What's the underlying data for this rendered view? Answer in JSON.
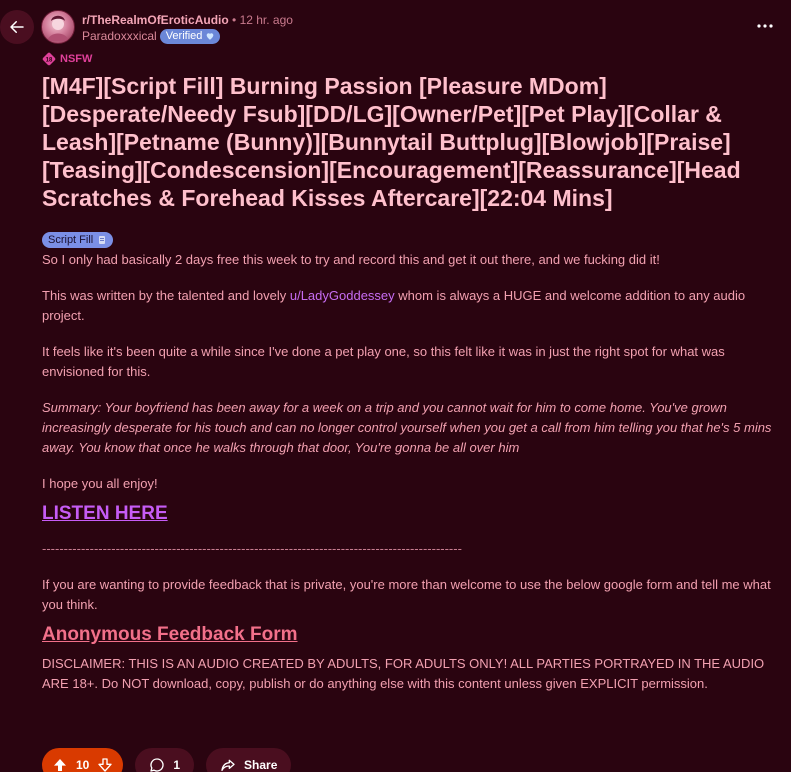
{
  "header": {
    "subreddit": "r/TheRealmOfEroticAudio",
    "separator": "•",
    "time_ago": "12 hr. ago",
    "username": "Paradoxxxical",
    "verified_label": "Verified"
  },
  "nsfw_label": "NSFW",
  "post": {
    "title": "[M4F][Script Fill] Burning Passion [Pleasure MDom][Desperate/Needy Fsub][DD/LG][Owner/Pet][Pet Play][Collar & Leash][Petname (Bunny)][Bunnytail Buttplug][Blowjob][Praise][Teasing][Condescension][Encouragement][Reassurance][Head Scratches & Forehead Kisses Aftercare][22:04 Mins]",
    "flair": "Script Fill",
    "paragraph_1": "So I only had basically 2 days free this week to try and record this and get it out there, and we fucking did it!",
    "paragraph_2_before": "This was written by the talented and lovely ",
    "paragraph_2_link": "u/LadyGoddessey",
    "paragraph_2_after": " whom is always a HUGE and welcome addition to any audio project.",
    "paragraph_3": "It feels like it's been quite a while since I've done a pet play one, so this felt like it was in just the right spot for what was envisioned for this.",
    "summary": "Summary: Your boyfriend has been away for a week on a trip and you cannot wait for him to come home. You've grown increasingly desperate for his touch and can no longer control yourself when you get a call from him telling you that he's 5 mins away. You know that once he walks through that door, You're gonna be all over him",
    "enjoy": "I hope you all enjoy!",
    "listen_link": "LISTEN HERE",
    "divider": "-------------------------------------------------------------------------------------------------",
    "feedback_text": "If you are wanting to provide feedback that is private, you're more than welcome to use the below google form and tell me what you think.",
    "feedback_link": "Anonymous Feedback Form",
    "disclaimer": "DISCLAIMER: THIS IS AN AUDIO CREATED BY ADULTS, FOR ADULTS ONLY! ALL PARTIES PORTRAYED IN THE AUDIO ARE 18+. Do NOT download, copy, publish or do anything else with this content unless given EXPLICIT permission."
  },
  "actions": {
    "vote_count": "10",
    "comment_count": "1",
    "share_label": "Share"
  },
  "icons": {
    "back": "back-arrow-icon",
    "more": "more-horizontal-icon",
    "nsfw": "nsfw-18-icon",
    "upvote": "upvote-icon",
    "downvote": "downvote-icon",
    "comment": "comment-icon",
    "share": "share-icon",
    "verified_heart": "heart-icon",
    "flair_emoji": "flair-emoji-icon"
  },
  "colors": {
    "background": "#2a0410",
    "title": "#ffc0cc",
    "body_text": "#f2a0b0",
    "listen_link": "#c65cf5",
    "feedback_link": "#f2708a",
    "upvote_active": "#d93a00",
    "verified_badge": "#6b87d8",
    "flair": "#7b8fe6",
    "nsfw": "#e0409a"
  }
}
